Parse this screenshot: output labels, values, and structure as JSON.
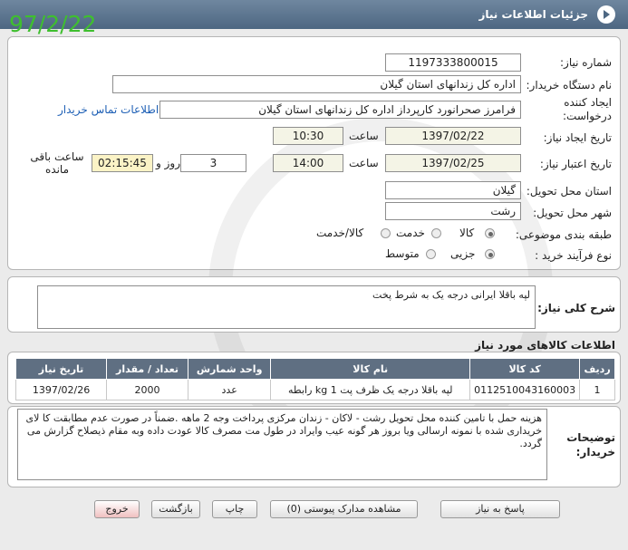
{
  "title": "جزئیات اطلاعات نیاز",
  "date_stamp": "97/2/22",
  "labels": {
    "need_number": "شماره نیاز:",
    "buyer_org": "نام دستگاه خریدار:",
    "creator": "ایجاد کننده درخواست:",
    "created_date": "تاریخ ایجاد نیاز:",
    "validity_date": "تاریخ اعتبار نیاز:",
    "time": "ساعت",
    "day_and": "روز و",
    "remaining": "ساعت باقی مانده",
    "province": "استان محل تحویل:",
    "city": "شهر محل تحویل:",
    "category": "طبقه بندی موضوعی:",
    "purchase_type": "نوع فرآیند خرید :",
    "general_desc": "شرح کلی نیاز:",
    "items_title": "اطلاعات کالاهای مورد نیاز",
    "buyer_notes": "توضیحات خریدار:"
  },
  "values": {
    "need_number": "1197333800015",
    "buyer_org": "اداره کل زندانهای استان گیلان",
    "creator": "فرامرز صحرانورد کارپرداز اداره کل زندانهای استان گیلان",
    "contact_link": "اطلاعات تماس خریدار",
    "created_date": "1397/02/22",
    "created_time": "10:30",
    "validity_date": "1397/02/25",
    "validity_time": "14:00",
    "remaining_days": "3",
    "remaining_time": "02:15:45",
    "province": "گیلان",
    "city": "رشت",
    "general_desc": "لپه باقلا ایرانی درجه یک  به شرط پخت",
    "buyer_notes": "هزینه حمل با تامین کننده محل تحویل رشت - لاکان - زندان مرکزی  پرداخت وجه 2 ماهه .ضمناً در صورت عدم مطابقت کا لای خریداری شده با نمونه ارسالی  ویا بروز هر گونه عیب وایراد در طول مت مصرف کالا عودت داده وبه مقام ذیصلاح گزارش می گردد."
  },
  "category_options": [
    "کالا",
    "خدمت",
    "کالا/خدمت"
  ],
  "purchase_options": [
    "جزیی",
    "متوسط"
  ],
  "table": {
    "headers": [
      "ردیف",
      "کد کالا",
      "نام کالا",
      "واحد شمارش",
      "تعداد / مقدار",
      "تاریخ نیاز"
    ],
    "rows": [
      [
        "1",
        "0112510043160003",
        "لپه باقلا درجه یک ظرف پت kg 1 رابطه",
        "عدد",
        "2000",
        "1397/02/26"
      ]
    ]
  },
  "buttons": {
    "reply": "پاسخ به نیاز",
    "attachments": "مشاهده مدارک پیوستی (0)",
    "print": "چاپ",
    "back": "بازگشت",
    "exit": "خروج"
  }
}
